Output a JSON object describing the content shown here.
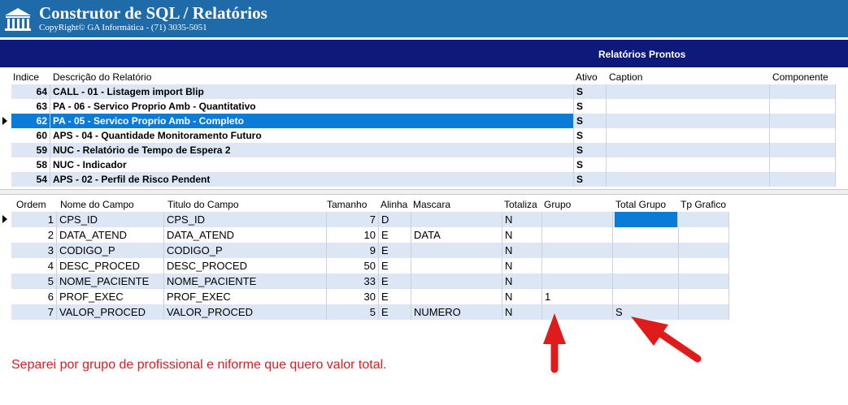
{
  "app": {
    "title": "Construtor de SQL / Relatórios",
    "subtitle": "CopyRight© GA Informática - (71) 3035-5051"
  },
  "panel": {
    "title": "Relatórios Prontos"
  },
  "reports": {
    "columns": [
      "Indice",
      "Descrição do Relatório",
      "Ativo",
      "Caption",
      "Componente"
    ],
    "selected_index": 2,
    "rows": [
      {
        "indice": "64",
        "descricao": "CALL - 01 - Listagem import Blip",
        "ativo": "S",
        "caption": "",
        "componente": ""
      },
      {
        "indice": "63",
        "descricao": "PA - 06 - Servico Proprio Amb - Quantitativo",
        "ativo": "S",
        "caption": "",
        "componente": ""
      },
      {
        "indice": "62",
        "descricao": "PA - 05 - Servico Proprio Amb - Completo",
        "ativo": "S",
        "caption": "",
        "componente": ""
      },
      {
        "indice": "60",
        "descricao": "APS - 04 - Quantidade Monitoramento Futuro",
        "ativo": "S",
        "caption": "",
        "componente": ""
      },
      {
        "indice": "59",
        "descricao": "NUC - Relatório de Tempo de Espera 2",
        "ativo": "S",
        "caption": "",
        "componente": ""
      },
      {
        "indice": "58",
        "descricao": "NUC - Indicador",
        "ativo": "S",
        "caption": "",
        "componente": ""
      },
      {
        "indice": "54",
        "descricao": "APS - 02 - Perfil de Risco Pendent",
        "ativo": "S",
        "caption": "",
        "componente": ""
      }
    ]
  },
  "fields": {
    "columns": [
      "Ordem",
      "Nome do Campo",
      "Titulo do Campo",
      "Tamanho",
      "Alinha",
      "Mascara",
      "Totaliza",
      "Grupo",
      "Total Grupo",
      "Tp Grafico"
    ],
    "rows": [
      {
        "ordem": "1",
        "nome": "CPS_ID",
        "titulo": "CPS_ID",
        "tamanho": "7",
        "alinha": "D",
        "mascara": "",
        "totaliza": "N",
        "grupo": "",
        "total_grupo": "",
        "tp_grafico": ""
      },
      {
        "ordem": "2",
        "nome": "DATA_ATEND",
        "titulo": "DATA_ATEND",
        "tamanho": "10",
        "alinha": "E",
        "mascara": "DATA",
        "totaliza": "N",
        "grupo": "",
        "total_grupo": "",
        "tp_grafico": ""
      },
      {
        "ordem": "3",
        "nome": "CODIGO_P",
        "titulo": "CODIGO_P",
        "tamanho": "9",
        "alinha": "E",
        "mascara": "",
        "totaliza": "N",
        "grupo": "",
        "total_grupo": "",
        "tp_grafico": ""
      },
      {
        "ordem": "4",
        "nome": "DESC_PROCED",
        "titulo": "DESC_PROCED",
        "tamanho": "50",
        "alinha": "E",
        "mascara": "",
        "totaliza": "N",
        "grupo": "",
        "total_grupo": "",
        "tp_grafico": ""
      },
      {
        "ordem": "5",
        "nome": "NOME_PACIENTE",
        "titulo": "NOME_PACIENTE",
        "tamanho": "33",
        "alinha": "E",
        "mascara": "",
        "totaliza": "N",
        "grupo": "",
        "total_grupo": "",
        "tp_grafico": ""
      },
      {
        "ordem": "6",
        "nome": "PROF_EXEC",
        "titulo": "PROF_EXEC",
        "tamanho": "30",
        "alinha": "E",
        "mascara": "",
        "totaliza": "N",
        "grupo": "1",
        "total_grupo": "",
        "tp_grafico": ""
      },
      {
        "ordem": "7",
        "nome": "VALOR_PROCED",
        "titulo": "VALOR_PROCED",
        "tamanho": "5",
        "alinha": "E",
        "mascara": "NUMERO",
        "totaliza": "N",
        "grupo": "",
        "total_grupo": "S",
        "tp_grafico": ""
      }
    ]
  },
  "annotation": {
    "text": "Separei por grupo de profissional e niforme que quero valor total.",
    "color": "#d42020"
  },
  "colors": {
    "titlebar": "#1f6aa8",
    "panel_bar": "#0d1a7a",
    "selection": "#0a7bd6",
    "row_alt": "#dce6f4"
  }
}
